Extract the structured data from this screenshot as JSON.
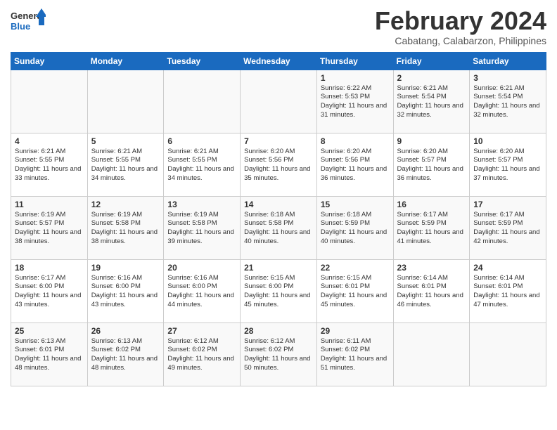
{
  "logo": {
    "line1": "General",
    "line2": "Blue"
  },
  "title": "February 2024",
  "location": "Cabatang, Calabarzon, Philippines",
  "days_of_week": [
    "Sunday",
    "Monday",
    "Tuesday",
    "Wednesday",
    "Thursday",
    "Friday",
    "Saturday"
  ],
  "weeks": [
    [
      {
        "day": "",
        "info": ""
      },
      {
        "day": "",
        "info": ""
      },
      {
        "day": "",
        "info": ""
      },
      {
        "day": "",
        "info": ""
      },
      {
        "day": "1",
        "info": "Sunrise: 6:22 AM\nSunset: 5:53 PM\nDaylight: 11 hours and 31 minutes."
      },
      {
        "day": "2",
        "info": "Sunrise: 6:21 AM\nSunset: 5:54 PM\nDaylight: 11 hours and 32 minutes."
      },
      {
        "day": "3",
        "info": "Sunrise: 6:21 AM\nSunset: 5:54 PM\nDaylight: 11 hours and 32 minutes."
      }
    ],
    [
      {
        "day": "4",
        "info": "Sunrise: 6:21 AM\nSunset: 5:55 PM\nDaylight: 11 hours and 33 minutes."
      },
      {
        "day": "5",
        "info": "Sunrise: 6:21 AM\nSunset: 5:55 PM\nDaylight: 11 hours and 34 minutes."
      },
      {
        "day": "6",
        "info": "Sunrise: 6:21 AM\nSunset: 5:55 PM\nDaylight: 11 hours and 34 minutes."
      },
      {
        "day": "7",
        "info": "Sunrise: 6:20 AM\nSunset: 5:56 PM\nDaylight: 11 hours and 35 minutes."
      },
      {
        "day": "8",
        "info": "Sunrise: 6:20 AM\nSunset: 5:56 PM\nDaylight: 11 hours and 36 minutes."
      },
      {
        "day": "9",
        "info": "Sunrise: 6:20 AM\nSunset: 5:57 PM\nDaylight: 11 hours and 36 minutes."
      },
      {
        "day": "10",
        "info": "Sunrise: 6:20 AM\nSunset: 5:57 PM\nDaylight: 11 hours and 37 minutes."
      }
    ],
    [
      {
        "day": "11",
        "info": "Sunrise: 6:19 AM\nSunset: 5:57 PM\nDaylight: 11 hours and 38 minutes."
      },
      {
        "day": "12",
        "info": "Sunrise: 6:19 AM\nSunset: 5:58 PM\nDaylight: 11 hours and 38 minutes."
      },
      {
        "day": "13",
        "info": "Sunrise: 6:19 AM\nSunset: 5:58 PM\nDaylight: 11 hours and 39 minutes."
      },
      {
        "day": "14",
        "info": "Sunrise: 6:18 AM\nSunset: 5:58 PM\nDaylight: 11 hours and 40 minutes."
      },
      {
        "day": "15",
        "info": "Sunrise: 6:18 AM\nSunset: 5:59 PM\nDaylight: 11 hours and 40 minutes."
      },
      {
        "day": "16",
        "info": "Sunrise: 6:17 AM\nSunset: 5:59 PM\nDaylight: 11 hours and 41 minutes."
      },
      {
        "day": "17",
        "info": "Sunrise: 6:17 AM\nSunset: 5:59 PM\nDaylight: 11 hours and 42 minutes."
      }
    ],
    [
      {
        "day": "18",
        "info": "Sunrise: 6:17 AM\nSunset: 6:00 PM\nDaylight: 11 hours and 43 minutes."
      },
      {
        "day": "19",
        "info": "Sunrise: 6:16 AM\nSunset: 6:00 PM\nDaylight: 11 hours and 43 minutes."
      },
      {
        "day": "20",
        "info": "Sunrise: 6:16 AM\nSunset: 6:00 PM\nDaylight: 11 hours and 44 minutes."
      },
      {
        "day": "21",
        "info": "Sunrise: 6:15 AM\nSunset: 6:00 PM\nDaylight: 11 hours and 45 minutes."
      },
      {
        "day": "22",
        "info": "Sunrise: 6:15 AM\nSunset: 6:01 PM\nDaylight: 11 hours and 45 minutes."
      },
      {
        "day": "23",
        "info": "Sunrise: 6:14 AM\nSunset: 6:01 PM\nDaylight: 11 hours and 46 minutes."
      },
      {
        "day": "24",
        "info": "Sunrise: 6:14 AM\nSunset: 6:01 PM\nDaylight: 11 hours and 47 minutes."
      }
    ],
    [
      {
        "day": "25",
        "info": "Sunrise: 6:13 AM\nSunset: 6:01 PM\nDaylight: 11 hours and 48 minutes."
      },
      {
        "day": "26",
        "info": "Sunrise: 6:13 AM\nSunset: 6:02 PM\nDaylight: 11 hours and 48 minutes."
      },
      {
        "day": "27",
        "info": "Sunrise: 6:12 AM\nSunset: 6:02 PM\nDaylight: 11 hours and 49 minutes."
      },
      {
        "day": "28",
        "info": "Sunrise: 6:12 AM\nSunset: 6:02 PM\nDaylight: 11 hours and 50 minutes."
      },
      {
        "day": "29",
        "info": "Sunrise: 6:11 AM\nSunset: 6:02 PM\nDaylight: 11 hours and 51 minutes."
      },
      {
        "day": "",
        "info": ""
      },
      {
        "day": "",
        "info": ""
      }
    ]
  ]
}
